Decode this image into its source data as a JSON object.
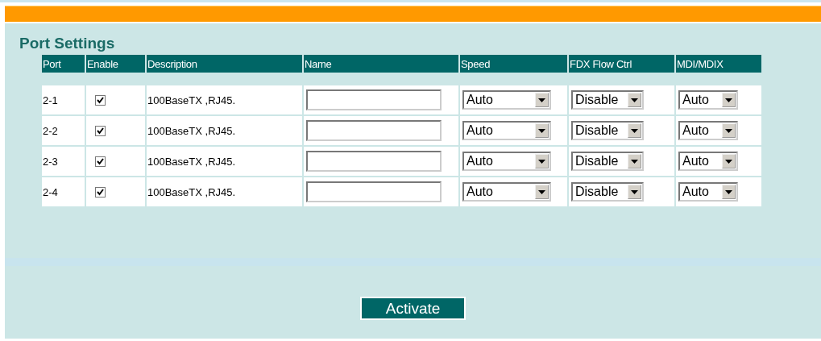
{
  "title": "Port Settings",
  "columns": [
    "Port",
    "Enable",
    "Description",
    "Name",
    "Speed",
    "FDX Flow Ctrl",
    "MDI/MDIX"
  ],
  "rows": [
    {
      "port": "2-1",
      "enabled": true,
      "description": "100BaseTX ,RJ45.",
      "speed": "Auto",
      "fdx": "Disable",
      "mdi": "Auto"
    },
    {
      "port": "2-2",
      "enabled": true,
      "description": "100BaseTX ,RJ45.",
      "speed": "Auto",
      "fdx": "Disable",
      "mdi": "Auto"
    },
    {
      "port": "2-3",
      "enabled": true,
      "description": "100BaseTX ,RJ45.",
      "speed": "Auto",
      "fdx": "Disable",
      "mdi": "Auto"
    },
    {
      "port": "2-4",
      "enabled": true,
      "description": "100BaseTX ,RJ45.",
      "speed": "Auto",
      "fdx": "Disable",
      "mdi": "Auto"
    }
  ],
  "button": "Activate"
}
